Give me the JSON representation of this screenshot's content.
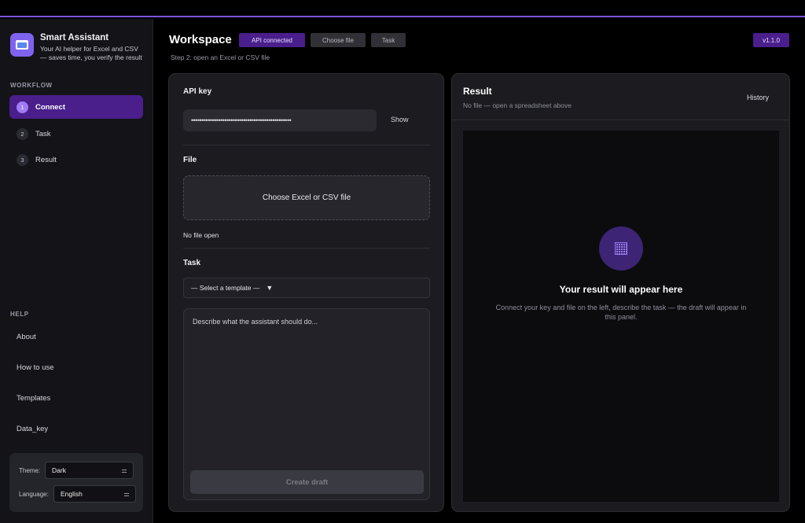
{
  "brand": {
    "title": "Smart Assistant",
    "subtitle": "Your AI helper for Excel and CSV — saves time, you verify the result"
  },
  "workflow": {
    "label": "WORKFLOW",
    "items": [
      {
        "num": "1",
        "label": "Connect",
        "active": true
      },
      {
        "num": "2",
        "label": "Task",
        "active": false
      },
      {
        "num": "3",
        "label": "Result",
        "active": false
      }
    ]
  },
  "help": {
    "label": "HELP",
    "items": [
      "About",
      "How to use",
      "Templates",
      "Data_key"
    ]
  },
  "settings": {
    "theme_label": "Theme:",
    "theme_value": "Dark",
    "language_label": "Language:",
    "language_value": "English"
  },
  "header": {
    "title": "Workspace",
    "chip_api": "API connected",
    "chip_file": "Choose file",
    "chip_task": "Task",
    "version": "v1.1.0",
    "step": "Step 2: open an Excel or CSV file"
  },
  "left": {
    "api_key_heading": "API key",
    "api_key_masked": "••••••••••••••••••••••••••••••••••••••••••••••••",
    "show_label": "Show",
    "file_heading": "File",
    "drop_label": "Choose Excel or CSV file",
    "no_file": "No file open",
    "task_heading": "Task",
    "template_select": "— Select a template —",
    "template_arrow": "▼",
    "task_placeholder": "Describe what the assistant should do...",
    "create_label": "Create draft"
  },
  "right": {
    "title": "Result",
    "subtitle": "No file — open a spreadsheet above",
    "history_label": "History",
    "empty_title": "Your result will appear here",
    "empty_desc": "Connect your key and file on the left, describe the task — the draft will appear in this panel."
  },
  "colors": {
    "accent": "#4a1f8c",
    "accent_light": "#a07cf5",
    "top_border": "#7b55e0"
  }
}
